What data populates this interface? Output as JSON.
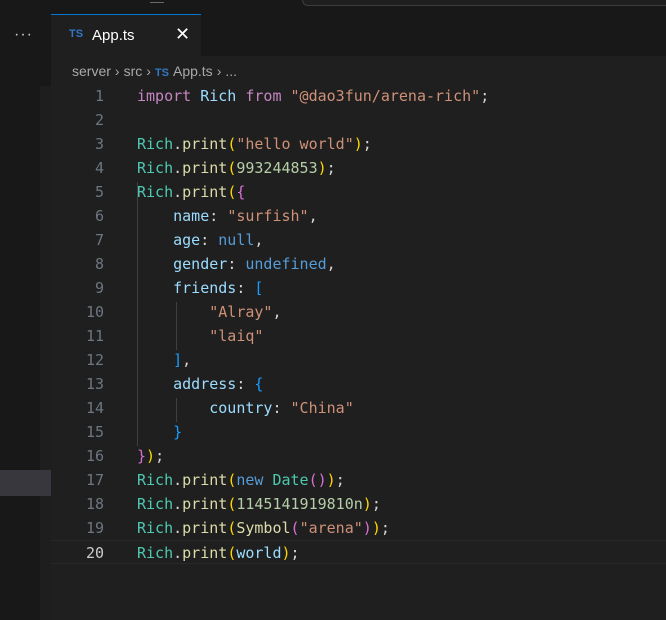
{
  "activity": {
    "more_label": "···"
  },
  "tab": {
    "lang": "TS",
    "filename": "App.ts",
    "close": "✕"
  },
  "breadcrumb": {
    "items": [
      "server",
      "src",
      "App.ts",
      "..."
    ],
    "lang": "TS"
  },
  "editor": {
    "current_line": 20
  },
  "code_lines": [
    {
      "n": "1",
      "tokens": [
        [
          "kw",
          "import"
        ],
        [
          "plain",
          " "
        ],
        [
          "prop",
          "Rich"
        ],
        [
          "plain",
          " "
        ],
        [
          "kw",
          "from"
        ],
        [
          "plain",
          " "
        ],
        [
          "str",
          "\"@dao3fun/arena-rich\""
        ],
        [
          "plain",
          ";"
        ]
      ]
    },
    {
      "n": "2",
      "tokens": []
    },
    {
      "n": "3",
      "tokens": [
        [
          "cls",
          "Rich"
        ],
        [
          "plain",
          "."
        ],
        [
          "fn",
          "print"
        ],
        [
          "b1",
          "("
        ],
        [
          "str",
          "\"hello world\""
        ],
        [
          "b1",
          ")"
        ],
        [
          "plain",
          ";"
        ]
      ]
    },
    {
      "n": "4",
      "tokens": [
        [
          "cls",
          "Rich"
        ],
        [
          "plain",
          "."
        ],
        [
          "fn",
          "print"
        ],
        [
          "b1",
          "("
        ],
        [
          "num",
          "993244853"
        ],
        [
          "b1",
          ")"
        ],
        [
          "plain",
          ";"
        ]
      ]
    },
    {
      "n": "5",
      "tokens": [
        [
          "cls",
          "Rich"
        ],
        [
          "plain",
          "."
        ],
        [
          "fn",
          "print"
        ],
        [
          "b1",
          "("
        ],
        [
          "b2",
          "{"
        ]
      ]
    },
    {
      "n": "6",
      "tokens": [
        [
          "plain",
          "    "
        ],
        [
          "prop",
          "name"
        ],
        [
          "plain",
          ": "
        ],
        [
          "str",
          "\"surfish\""
        ],
        [
          "plain",
          ","
        ]
      ]
    },
    {
      "n": "7",
      "tokens": [
        [
          "plain",
          "    "
        ],
        [
          "prop",
          "age"
        ],
        [
          "plain",
          ": "
        ],
        [
          "const",
          "null"
        ],
        [
          "plain",
          ","
        ]
      ]
    },
    {
      "n": "8",
      "tokens": [
        [
          "plain",
          "    "
        ],
        [
          "prop",
          "gender"
        ],
        [
          "plain",
          ": "
        ],
        [
          "const",
          "undefined"
        ],
        [
          "plain",
          ","
        ]
      ]
    },
    {
      "n": "9",
      "tokens": [
        [
          "plain",
          "    "
        ],
        [
          "prop",
          "friends"
        ],
        [
          "plain",
          ": "
        ],
        [
          "b3",
          "["
        ]
      ]
    },
    {
      "n": "10",
      "tokens": [
        [
          "plain",
          "        "
        ],
        [
          "str",
          "\"Alray\""
        ],
        [
          "plain",
          ","
        ]
      ]
    },
    {
      "n": "11",
      "tokens": [
        [
          "plain",
          "        "
        ],
        [
          "str",
          "\"laiq\""
        ]
      ]
    },
    {
      "n": "12",
      "tokens": [
        [
          "plain",
          "    "
        ],
        [
          "b3",
          "]"
        ],
        [
          "plain",
          ","
        ]
      ]
    },
    {
      "n": "13",
      "tokens": [
        [
          "plain",
          "    "
        ],
        [
          "prop",
          "address"
        ],
        [
          "plain",
          ": "
        ],
        [
          "b3",
          "{"
        ]
      ]
    },
    {
      "n": "14",
      "tokens": [
        [
          "plain",
          "        "
        ],
        [
          "prop",
          "country"
        ],
        [
          "plain",
          ": "
        ],
        [
          "str",
          "\"China\""
        ]
      ]
    },
    {
      "n": "15",
      "tokens": [
        [
          "plain",
          "    "
        ],
        [
          "b3",
          "}"
        ]
      ]
    },
    {
      "n": "16",
      "tokens": [
        [
          "b2",
          "}"
        ],
        [
          "b1",
          ")"
        ],
        [
          "plain",
          ";"
        ]
      ]
    },
    {
      "n": "17",
      "tokens": [
        [
          "cls",
          "Rich"
        ],
        [
          "plain",
          "."
        ],
        [
          "fn",
          "print"
        ],
        [
          "b1",
          "("
        ],
        [
          "const",
          "new"
        ],
        [
          "plain",
          " "
        ],
        [
          "cls",
          "Date"
        ],
        [
          "b2",
          "()"
        ],
        [
          "b1",
          ")"
        ],
        [
          "plain",
          ";"
        ]
      ]
    },
    {
      "n": "18",
      "tokens": [
        [
          "cls",
          "Rich"
        ],
        [
          "plain",
          "."
        ],
        [
          "fn",
          "print"
        ],
        [
          "b1",
          "("
        ],
        [
          "num",
          "1145141919810n"
        ],
        [
          "b1",
          ")"
        ],
        [
          "plain",
          ";"
        ]
      ]
    },
    {
      "n": "19",
      "tokens": [
        [
          "cls",
          "Rich"
        ],
        [
          "plain",
          "."
        ],
        [
          "fn",
          "print"
        ],
        [
          "b1",
          "("
        ],
        [
          "fn",
          "Symbol"
        ],
        [
          "b2",
          "("
        ],
        [
          "str",
          "\"arena\""
        ],
        [
          "b2",
          ")"
        ],
        [
          "b1",
          ")"
        ],
        [
          "plain",
          ";"
        ]
      ]
    },
    {
      "n": "20",
      "tokens": [
        [
          "cls",
          "Rich"
        ],
        [
          "plain",
          "."
        ],
        [
          "fn",
          "print"
        ],
        [
          "b1",
          "("
        ],
        [
          "prop",
          "world"
        ],
        [
          "b1",
          ")"
        ],
        [
          "plain",
          ";"
        ]
      ]
    }
  ]
}
